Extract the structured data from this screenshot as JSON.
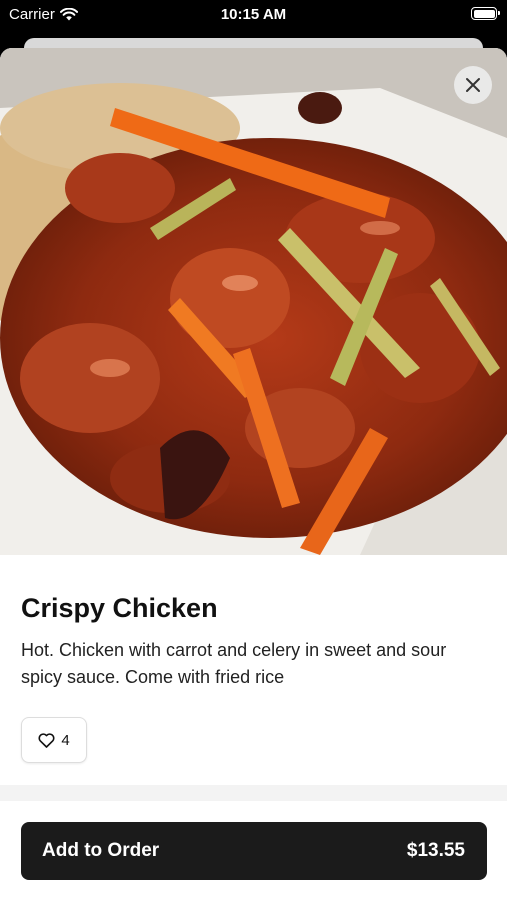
{
  "status_bar": {
    "carrier": "Carrier",
    "time": "10:15 AM"
  },
  "item": {
    "image": "crispy-chicken-photo",
    "title": "Crispy Chicken",
    "description": "Hot. Chicken with carrot and celery in sweet and sour spicy sauce. Come with fried rice",
    "likes": "4"
  },
  "actions": {
    "close_icon": "close-icon",
    "like_icon": "heart-icon",
    "order_label": "Add to Order",
    "order_price": "$13.55"
  },
  "colors": {
    "order_button": "#1b1b1b",
    "background": "#ffffff"
  }
}
